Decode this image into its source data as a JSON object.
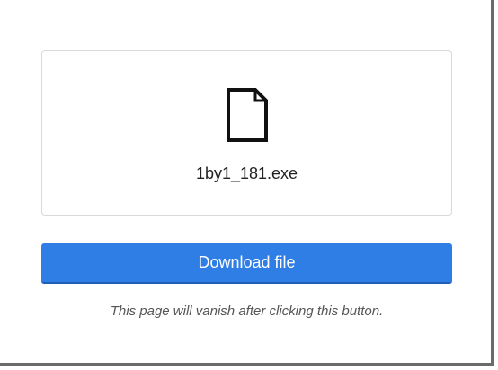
{
  "file": {
    "name": "1by1_181.exe",
    "icon": "document-icon"
  },
  "actions": {
    "download_label": "Download file"
  },
  "notice": {
    "text": "This page will vanish after clicking this button."
  },
  "colors": {
    "accent": "#2f7ee6",
    "accent_border": "#1f5fb8",
    "card_border": "#d9d9d9",
    "text": "#222222",
    "hint_text": "#555555"
  }
}
